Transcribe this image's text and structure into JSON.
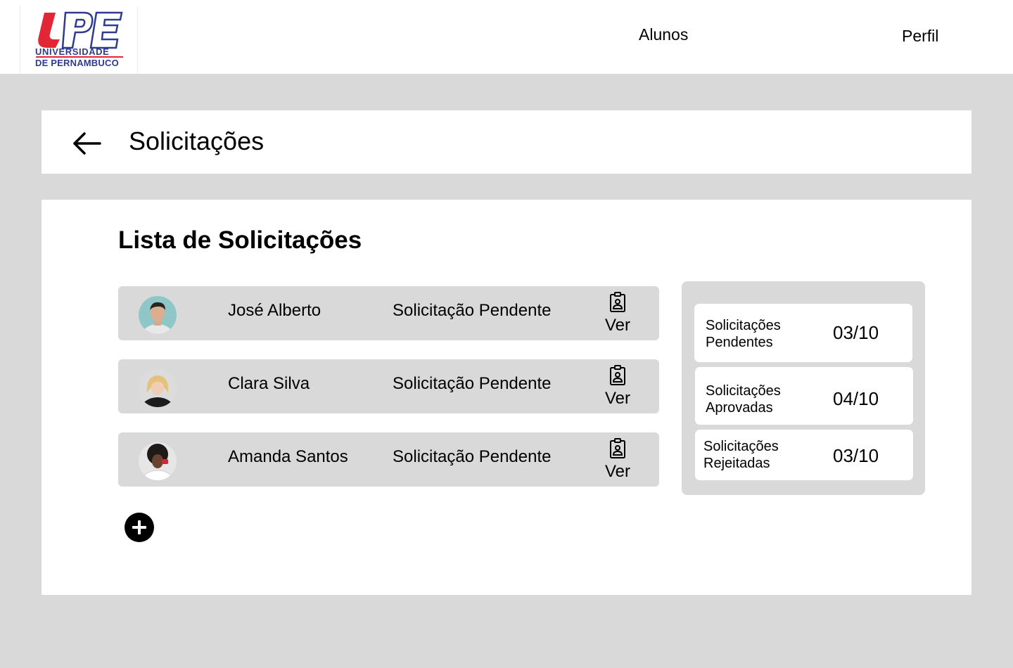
{
  "header": {
    "logo": {
      "mark": "UPE",
      "line1": "UNIVERSIDADE",
      "line2": "DE PERNAMBUCO",
      "colors": {
        "red": "#e32636",
        "blue": "#2e3b8f"
      }
    },
    "nav": [
      {
        "label": "Alunos"
      },
      {
        "label": "Perfil"
      }
    ]
  },
  "page": {
    "title": "Solicitações",
    "back_icon": "arrow-left-icon"
  },
  "list": {
    "title": "Lista de Solicitações",
    "rows": [
      {
        "name": "José Alberto",
        "status": "Solicitação Pendente",
        "action": "Ver",
        "icon": "clipboard-user-icon"
      },
      {
        "name": "Clara Silva",
        "status": "Solicitação Pendente",
        "action": "Ver",
        "icon": "clipboard-user-icon"
      },
      {
        "name": "Amanda Santos",
        "status": "Solicitação Pendente",
        "action": "Ver",
        "icon": "clipboard-user-icon"
      }
    ],
    "add_icon": "plus-circle-icon"
  },
  "stats": [
    {
      "label": "Solicitações\nPendentes",
      "value": "03/10"
    },
    {
      "label": "Solicitações\nAprovadas",
      "value": "04/10"
    },
    {
      "label": "Solicitações\nRejeitadas",
      "value": "03/10"
    }
  ],
  "colors": {
    "background": "#d9d9d9",
    "card": "#ffffff",
    "row": "#d9d9d9"
  }
}
